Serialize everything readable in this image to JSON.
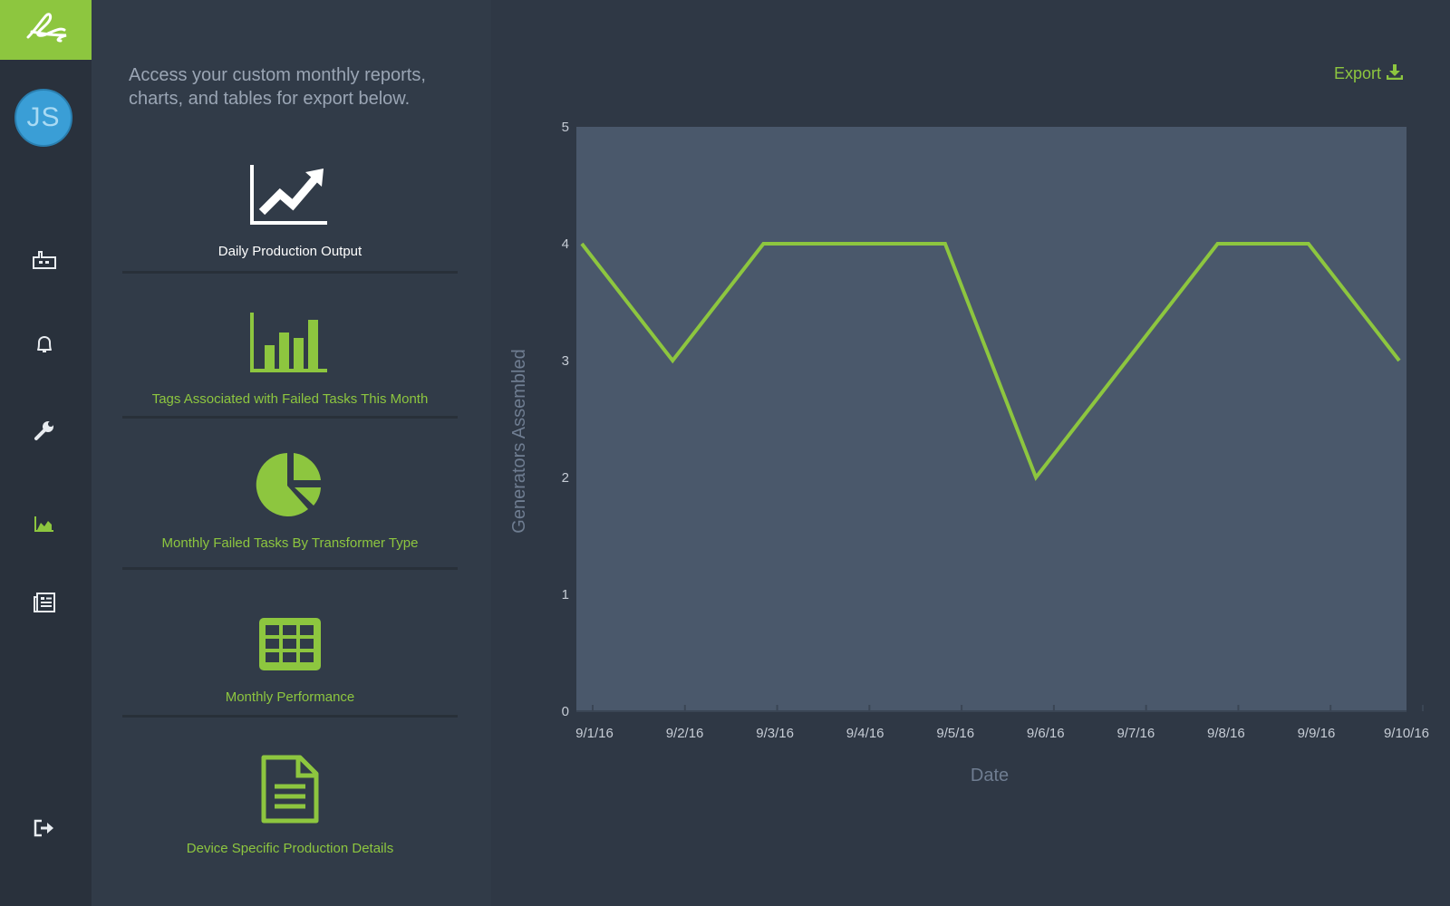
{
  "sidebar": {
    "logo_icon": "signature-logo-icon",
    "avatar_initials": "JS",
    "items": [
      {
        "name": "factory",
        "icon": "factory-icon"
      },
      {
        "name": "alerts",
        "icon": "bell-icon"
      },
      {
        "name": "maintenance",
        "icon": "wrench-icon"
      },
      {
        "name": "reports",
        "icon": "area-chart-icon",
        "active": true
      },
      {
        "name": "documents",
        "icon": "newspaper-icon"
      }
    ],
    "logout_icon": "logout-icon"
  },
  "panel": {
    "intro": "Access your custom monthly reports, charts, and tables for export below.",
    "reports": [
      {
        "label": "Daily Production Output",
        "icon": "line-chart-up-icon",
        "active": true
      },
      {
        "label": "Tags Associated with Failed Tasks This Month",
        "icon": "bar-chart-icon"
      },
      {
        "label": "Monthly Failed Tasks By Transformer Type",
        "icon": "pie-chart-icon"
      },
      {
        "label": "Monthly Performance",
        "icon": "table-icon"
      },
      {
        "label": "Device Specific Production Details",
        "icon": "document-icon"
      }
    ]
  },
  "export": {
    "label": "Export",
    "icon": "download-icon"
  },
  "colors": {
    "accent": "#8dc63f",
    "plot_bg": "#4a586b",
    "page_bg": "#2f3845"
  },
  "chart_data": {
    "type": "line",
    "x": [
      "9/1/16",
      "9/2/16",
      "9/3/16",
      "9/4/16",
      "9/5/16",
      "9/6/16",
      "9/7/16",
      "9/8/16",
      "9/9/16",
      "9/10/16"
    ],
    "series": [
      {
        "values": [
          4,
          3,
          4,
          4,
          4,
          2,
          3,
          4,
          4,
          3
        ]
      }
    ],
    "xlabel": "Date",
    "ylabel": "Generators Assembled",
    "ylim": [
      0,
      5
    ],
    "yticks": [
      "0",
      "1",
      "2",
      "3",
      "4",
      "5"
    ],
    "grid": false,
    "legend": "none"
  }
}
